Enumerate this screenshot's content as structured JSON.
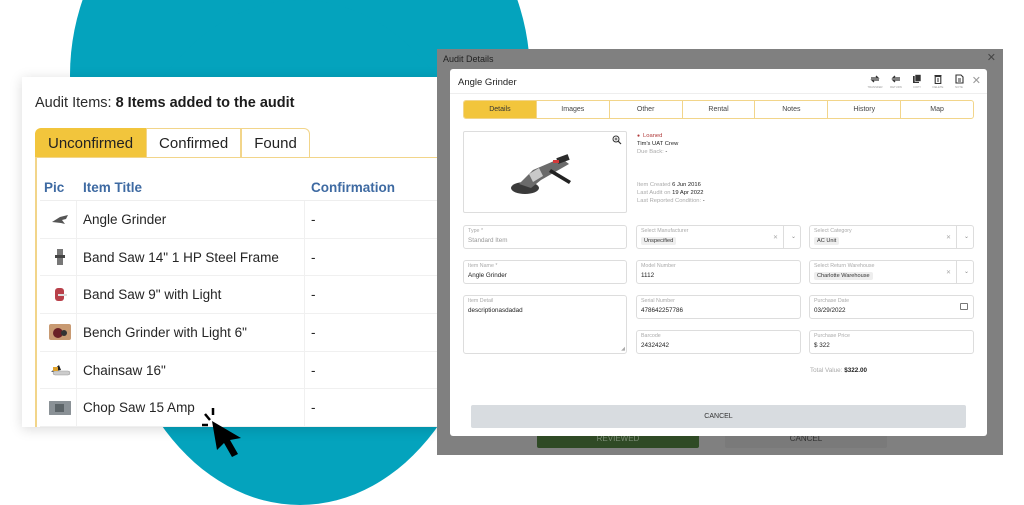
{
  "audit_card": {
    "heading_prefix": "Audit Items: ",
    "heading_bold": "8 Items added to the audit",
    "tabs": [
      {
        "label": "Unconfirmed",
        "active": true
      },
      {
        "label": "Confirmed",
        "active": false
      },
      {
        "label": "Found",
        "active": false
      }
    ],
    "columns": {
      "pic": "Pic",
      "title": "Item Title",
      "confirmation": "Confirmation"
    },
    "rows": [
      {
        "title": "Angle Grinder",
        "confirmation": "-",
        "thumb": "angle-grinder-thumb"
      },
      {
        "title": "Band Saw 14\" 1 HP Steel Frame",
        "confirmation": "-",
        "thumb": "band-saw-thumb"
      },
      {
        "title": "Band Saw 9\" with Light",
        "confirmation": "-",
        "thumb": "band-saw-light-thumb"
      },
      {
        "title": "Bench Grinder with Light 6\"",
        "confirmation": "-",
        "thumb": "bench-grinder-thumb"
      },
      {
        "title": "Chainsaw 16\"",
        "confirmation": "-",
        "thumb": "chainsaw-thumb"
      },
      {
        "title": "Chop Saw 15 Amp",
        "confirmation": "-",
        "thumb": "chop-saw-thumb"
      }
    ]
  },
  "backdrop": {
    "title": "Audit Details",
    "close": "✕",
    "reviewed_label": "REVIEWED",
    "cancel_label": "CANCEL"
  },
  "dialog": {
    "title": "Angle Grinder",
    "close": "✕",
    "toolbar": [
      {
        "label": "TRANSFER",
        "icon": "transfer-icon"
      },
      {
        "label": "RETURN",
        "icon": "return-icon"
      },
      {
        "label": "COPY",
        "icon": "copy-icon"
      },
      {
        "label": "DELETE",
        "icon": "delete-icon"
      },
      {
        "label": "NOTE",
        "icon": "note-icon"
      }
    ],
    "tabs": [
      {
        "label": "Details",
        "active": true
      },
      {
        "label": "Images",
        "active": false
      },
      {
        "label": "Other",
        "active": false
      },
      {
        "label": "Rental",
        "active": false
      },
      {
        "label": "Notes",
        "active": false
      },
      {
        "label": "History",
        "active": false
      },
      {
        "label": "Map",
        "active": false
      }
    ],
    "info": {
      "status": "Loaned",
      "assignee": "Tim's UAT Crew",
      "due_back_label": "Due Back:",
      "due_back_value": "-",
      "created_label": "Item Created",
      "created_value": "6 Jun 2016",
      "last_audit_label": "Last Audit  on",
      "last_audit_value": "19 Apr 2022",
      "condition_label": "Last Reported Condition:",
      "condition_value": "-"
    },
    "fields": {
      "type": {
        "label": "Type *",
        "value": "Standard Item"
      },
      "manufacturer": {
        "label": "Select Manufacturer",
        "value": "Unspecified"
      },
      "category": {
        "label": "Select Category",
        "value": "AC Unit"
      },
      "item_name": {
        "label": "Item Name *",
        "value": "Angle Grinder"
      },
      "model_number": {
        "label": "Model Number",
        "value": "1112"
      },
      "return_warehouse": {
        "label": "Select Return Warehouse",
        "value": "Charlotte Warehouse"
      },
      "item_detail": {
        "label": "Item Detail",
        "value": "descriptionasdadad"
      },
      "serial_number": {
        "label": "Serial Number",
        "value": "478642257786"
      },
      "purchase_date": {
        "label": "Purchase Date",
        "value": "03/29/2022"
      },
      "barcode": {
        "label": "Barcode",
        "value": "24324242"
      },
      "purchase_price": {
        "label": "Purchase Price",
        "value": "$ 322"
      }
    },
    "total_label": "Total Value:",
    "total_value": "$322.00",
    "cancel_label": "CANCEL"
  },
  "colors": {
    "accent_yellow": "#f2c53c",
    "teal_circle": "#04a3bd",
    "header_blue": "#3e6aa2",
    "loaned_red": "#b03a3a",
    "reviewed_green": "#2f4a25"
  }
}
